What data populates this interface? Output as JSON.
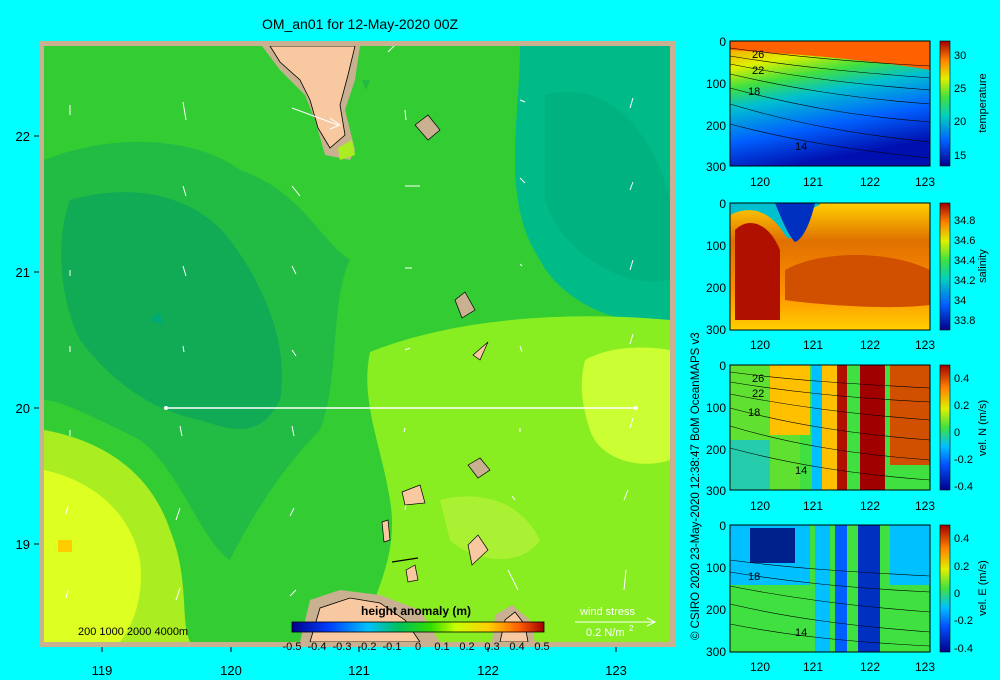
{
  "title": "OM_an01 for 12-May-2020 00Z",
  "copyright": "© CSIRO 2020  23-May-2020 12:38:47 BoM OceanMAPS v3",
  "colors": {
    "background": "#00ffff",
    "land": "#f8c8a0",
    "shelf": "#c8b090",
    "vector": "#ffffff",
    "frame": "#c8b090"
  },
  "map": {
    "xticks": [
      "119",
      "120",
      "121",
      "122",
      "123"
    ],
    "yticks": [
      "22",
      "21",
      "20",
      "19"
    ],
    "depth_legend": "200  1000  2000  4000m",
    "colorbar_title": "height anomaly (m)",
    "colorbar_ticks": [
      "-0.5",
      "-0.4",
      "-0.3",
      "-0.2",
      "-0.1",
      "0",
      "0.1",
      "0.2",
      "0.3",
      "0.4",
      "0.5"
    ],
    "wind_label": "wind stress",
    "wind_unit": "0.2 N/m",
    "wind_unit_sup": "2"
  },
  "chart_data": [
    {
      "type": "heatmap",
      "title": "OM_an01 for 12-May-2020 00Z",
      "variable": "height anomaly (m)",
      "x": [
        119,
        120,
        121,
        122,
        123
      ],
      "y": [
        19,
        20,
        21,
        22
      ],
      "xlim": [
        118.5,
        123.5
      ],
      "ylim": [
        18.3,
        22.7
      ],
      "clim": [
        -0.5,
        0.5
      ],
      "section": {
        "lat": 20,
        "lon_start": 119.5,
        "lon_end": 123.2
      },
      "vector_scale": "0.2 N/m2"
    },
    {
      "type": "heatmap",
      "cbar_label": "temperature",
      "xticks": [
        "120",
        "121",
        "122",
        "123"
      ],
      "yticks": [
        "0",
        "100",
        "200",
        "300"
      ],
      "cticks": [
        "30",
        "25",
        "20",
        "15"
      ],
      "clim": [
        13,
        32
      ],
      "contour_labels": [
        "26",
        "22",
        "18",
        "14"
      ],
      "xlim": [
        119.5,
        123.2
      ],
      "ylim": [
        300,
        0
      ]
    },
    {
      "type": "heatmap",
      "cbar_label": "salinity",
      "xticks": [
        "120",
        "121",
        "122",
        "123"
      ],
      "yticks": [
        "0",
        "100",
        "200",
        "300"
      ],
      "cticks": [
        "34.8",
        "34.6",
        "34.4",
        "34.2",
        "34",
        "33.8"
      ],
      "clim": [
        33.7,
        34.95
      ],
      "xlim": [
        119.5,
        123.2
      ],
      "ylim": [
        300,
        0
      ]
    },
    {
      "type": "heatmap",
      "cbar_label": "vel. N (m/s)",
      "xticks": [
        "120",
        "121",
        "122",
        "123"
      ],
      "yticks": [
        "0",
        "100",
        "200",
        "300"
      ],
      "cticks": [
        "0.4",
        "0.2",
        "0",
        "-0.2",
        "-0.4"
      ],
      "clim": [
        -0.5,
        0.5
      ],
      "contour_labels": [
        "26",
        "22",
        "18",
        "14"
      ],
      "xlim": [
        119.5,
        123.2
      ],
      "ylim": [
        300,
        0
      ]
    },
    {
      "type": "heatmap",
      "cbar_label": "vel. E (m/s)",
      "xticks": [
        "120",
        "121",
        "122",
        "123"
      ],
      "yticks": [
        "0",
        "100",
        "200",
        "300"
      ],
      "cticks": [
        "0.4",
        "0.2",
        "0",
        "-0.2",
        "-0.4"
      ],
      "clim": [
        -0.5,
        0.5
      ],
      "contour_labels": [
        "18",
        "14"
      ],
      "xlim": [
        119.5,
        123.2
      ],
      "ylim": [
        300,
        0
      ]
    }
  ]
}
